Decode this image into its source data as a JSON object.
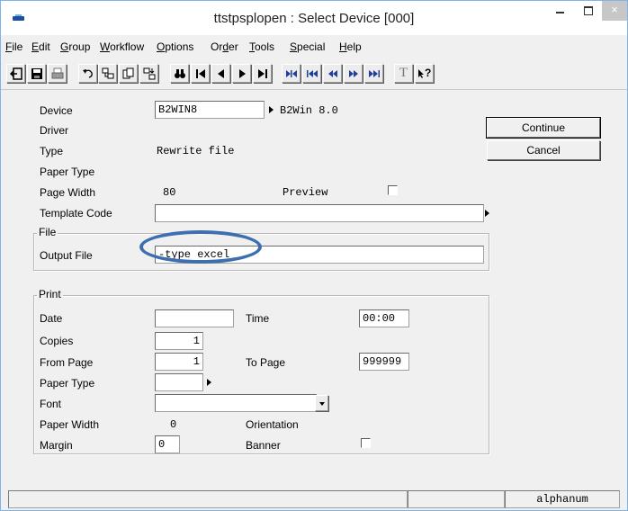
{
  "window": {
    "title": "ttstpsplopen : Select Device [000]",
    "controls": {
      "minimize": "–",
      "maximize": "□",
      "close": "×"
    }
  },
  "menubar": {
    "items": [
      {
        "label": "File",
        "mnemonic": "F"
      },
      {
        "label": "Edit",
        "mnemonic": "E"
      },
      {
        "label": "Group",
        "mnemonic": "G"
      },
      {
        "label": "Workflow",
        "mnemonic": "W"
      },
      {
        "label": "Options",
        "mnemonic": "O"
      },
      {
        "label": "Order",
        "mnemonic": "d"
      },
      {
        "label": "Tools",
        "mnemonic": "T"
      },
      {
        "label": "Special",
        "mnemonic": "S"
      },
      {
        "label": "Help",
        "mnemonic": "H"
      }
    ]
  },
  "toolbar": {
    "icons": [
      "exit-icon",
      "save-icon",
      "print-icon",
      "undo-icon",
      "insert-record-icon",
      "copy-record-icon",
      "special-icon",
      "find-icon",
      "first-record-icon",
      "previous-record-icon",
      "next-record-icon",
      "last-record-icon",
      "first-set-icon",
      "previous-set-icon",
      "previous-group-icon",
      "next-group-icon",
      "last-set-icon",
      "text-icon",
      "help-icon"
    ],
    "text_button_label": "T",
    "help_button_label": "?"
  },
  "form": {
    "device": {
      "label": "Device",
      "value": "B2WIN8",
      "description": "B2Win 8.0"
    },
    "driver": {
      "label": "Driver",
      "value": ""
    },
    "type": {
      "label": "Type",
      "value": "Rewrite file"
    },
    "paper_type": {
      "label": "Paper Type",
      "value": ""
    },
    "page_width": {
      "label": "Page Width",
      "value": "80"
    },
    "preview": {
      "label": "Preview",
      "checked": false
    },
    "template_code": {
      "label": "Template Code",
      "value": ""
    }
  },
  "file_group": {
    "title": "File",
    "output_file": {
      "label": "Output File",
      "value": "-type excel"
    }
  },
  "print_group": {
    "title": "Print",
    "date": {
      "label": "Date",
      "value": ""
    },
    "time": {
      "label": "Time",
      "value": "00:00"
    },
    "copies": {
      "label": "Copies",
      "value": "1"
    },
    "from_page": {
      "label": "From Page",
      "value": "1"
    },
    "to_page": {
      "label": "To Page",
      "value": "999999"
    },
    "paper_type": {
      "label": "Paper Type",
      "value": ""
    },
    "font": {
      "label": "Font",
      "value": ""
    },
    "paper_width": {
      "label": "Paper Width",
      "value": "0"
    },
    "orientation": {
      "label": "Orientation",
      "value": ""
    },
    "margin": {
      "label": "Margin",
      "value": "0"
    },
    "banner": {
      "label": "Banner",
      "checked": false
    }
  },
  "buttons": {
    "continue": "Continue",
    "cancel": "Cancel"
  },
  "statusbar": {
    "mode": "alphanum"
  },
  "colors": {
    "highlight_ellipse": "#3d6fb0",
    "window_border": "#7eb4ea"
  }
}
